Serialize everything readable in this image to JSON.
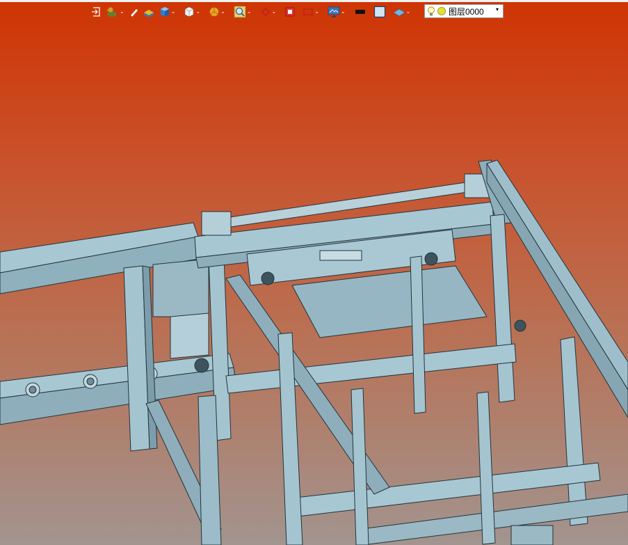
{
  "toolbar": {
    "items": [
      {
        "icon": "exit-icon"
      },
      {
        "icon": "duck-icon",
        "dropdown": true
      },
      {
        "icon": "pen-icon"
      },
      {
        "icon": "layer-box-icon"
      },
      {
        "icon": "cube-blue-icon",
        "dropdown": true
      },
      {
        "icon": "cube-white-icon",
        "dropdown": true
      },
      {
        "icon": "pie-icon",
        "dropdown": true
      },
      {
        "icon": "zoom-icon",
        "dropdown": true
      },
      {
        "icon": "rotate-icon",
        "dropdown": true
      },
      {
        "icon": "frame-icon"
      },
      {
        "icon": "dimension-icon",
        "dropdown": true
      },
      {
        "icon": "monitor-icon",
        "dropdown": true
      },
      {
        "icon": "color-black-icon"
      },
      {
        "icon": "color-box-icon"
      },
      {
        "icon": "layer-plane-icon",
        "dropdown": true
      }
    ],
    "dropdown_glyph": "⌄",
    "layer_select": {
      "value": "图层0000",
      "arrow": "▾"
    }
  },
  "colors": {
    "background_top": "#cf3403",
    "background_bottom": "#a2948f",
    "frame_face": "#9fc1cf",
    "frame_edge": "#22333a"
  }
}
